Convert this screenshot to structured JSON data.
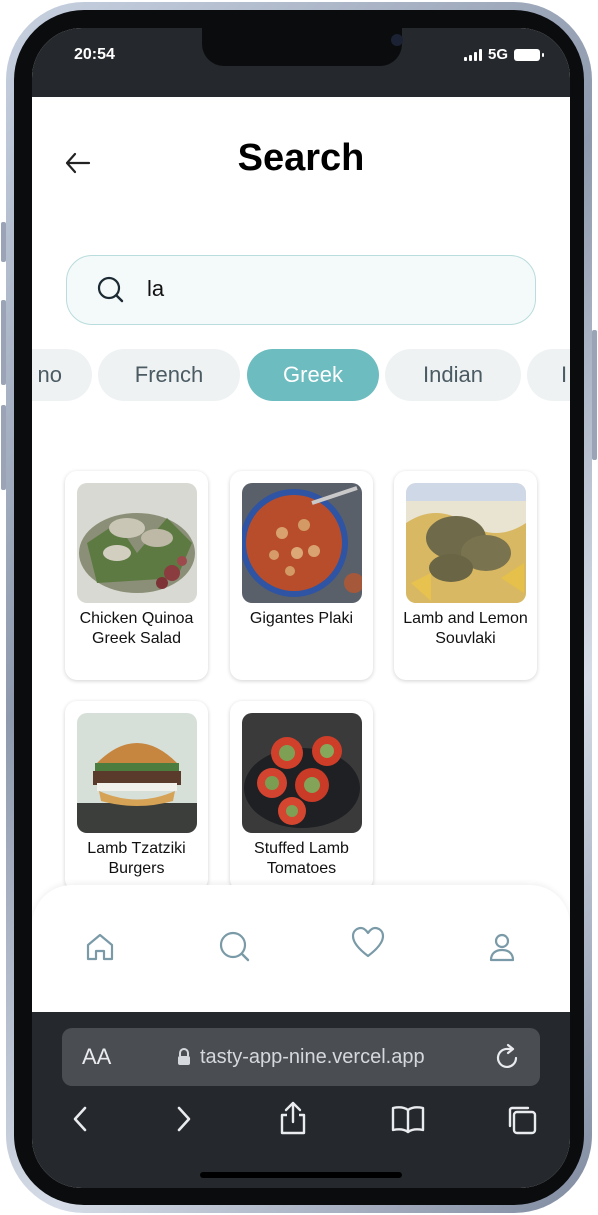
{
  "status_bar": {
    "time": "20:54",
    "network": "5G"
  },
  "header": {
    "title": "Search",
    "back_icon": "arrow-left-icon"
  },
  "search": {
    "value": "la",
    "icon": "search-icon",
    "border_color": "#b9dcdc"
  },
  "categories": {
    "items": [
      "no",
      "French",
      "Greek",
      "Indian",
      "I"
    ],
    "selected": "Greek",
    "active_color": "#6cbcc0"
  },
  "results": [
    {
      "name": "Chicken Quinoa Greek Salad"
    },
    {
      "name": "Gigantes Plaki"
    },
    {
      "name": "Lamb and Lemon Souvlaki"
    },
    {
      "name": "Lamb Tzatziki Burgers"
    },
    {
      "name": "Stuffed Lamb Tomatoes"
    }
  ],
  "tab_bar": {
    "items": [
      "home-icon",
      "search-icon",
      "heart-icon",
      "user-icon"
    ],
    "icon_color": "#7a9aa8"
  },
  "browser": {
    "text_size_label": "AA",
    "url": "tasty-app-nine.vercel.app",
    "buttons": [
      "back-icon",
      "forward-icon",
      "share-icon",
      "bookmarks-icon",
      "tabs-icon"
    ]
  }
}
